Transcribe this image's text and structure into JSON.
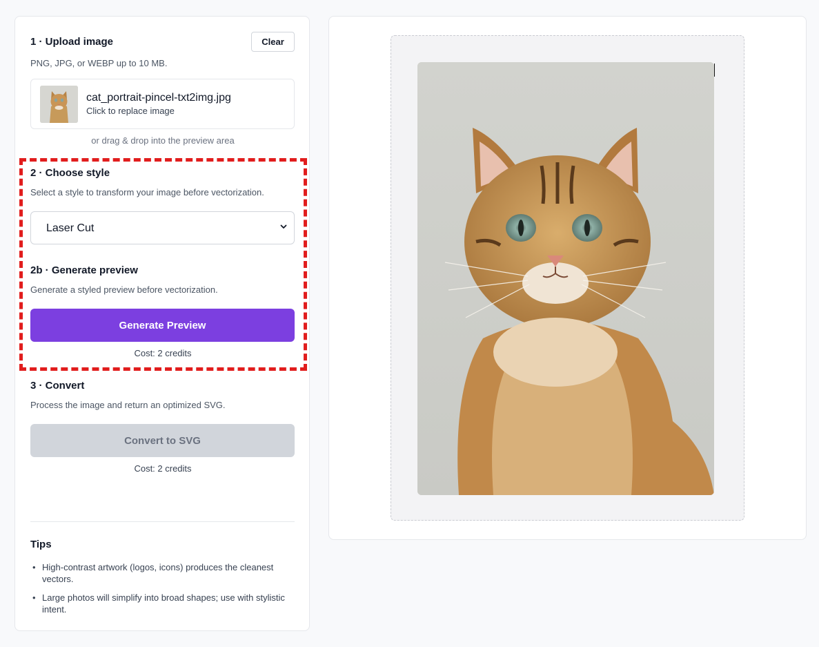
{
  "upload": {
    "title": "1 · Upload image",
    "clear_label": "Clear",
    "subtitle": "PNG, JPG, or WEBP up to 10 MB.",
    "file_name": "cat_portrait-pincel-txt2img.jpg",
    "file_hint": "Click to replace image",
    "drag_hint": "or drag & drop into the preview area"
  },
  "style": {
    "title": "2 · Choose style",
    "subtitle": "Select a style to transform your image before vectorization.",
    "selected": "Laser Cut"
  },
  "preview": {
    "title": "2b · Generate preview",
    "subtitle": "Generate a styled preview before vectorization.",
    "button_label": "Generate Preview",
    "cost": "Cost: 2 credits"
  },
  "convert": {
    "title": "3 · Convert",
    "subtitle": "Process the image and return an optimized SVG.",
    "button_label": "Convert to SVG",
    "cost": "Cost: 2 credits"
  },
  "tips": {
    "title": "Tips",
    "items": [
      "High-contrast artwork (logos, icons) produces the cleanest vectors.",
      "Large photos will simplify into broad shapes; use with stylistic intent."
    ]
  },
  "colors": {
    "accent": "#7c3fe0",
    "highlight": "#e11d1d",
    "disabled": "#d1d5db"
  }
}
